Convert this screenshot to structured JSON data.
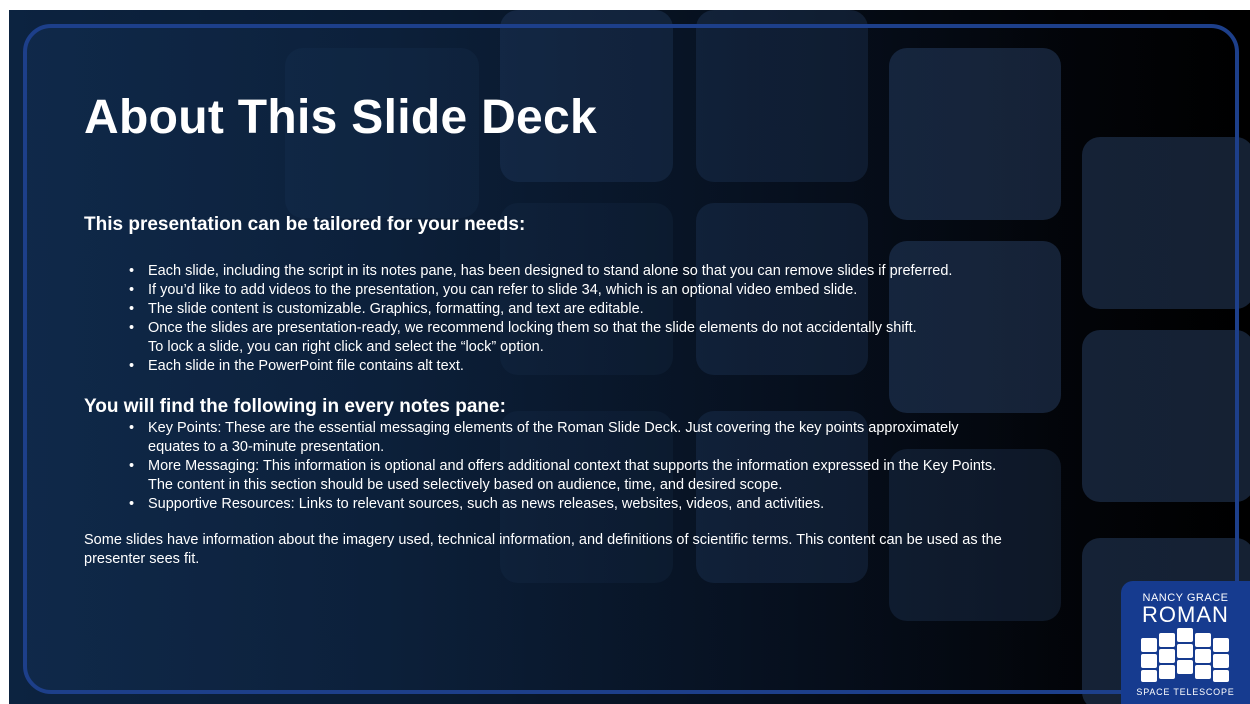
{
  "slide": {
    "title": "About This Slide Deck",
    "section1_heading": "This presentation can be tailored for your needs:",
    "section1_bullets": [
      "Each slide, including the script in its notes pane, has been designed to stand alone so that you can remove slides if preferred.",
      "If you’d like to add videos to the presentation, you can refer to slide 34, which is an optional video embed slide.",
      "The slide content is customizable. Graphics, formatting, and text are editable.",
      "Once the slides are presentation-ready, we recommend locking them so that the slide elements do not accidentally shift.",
      "To lock a slide, you can right click and select the “lock” option.",
      "Each slide in the PowerPoint file contains alt text."
    ],
    "section2_heading": "You will find the following in every notes pane:",
    "section2_bullets": [
      "Key Points: These are the essential messaging elements of the Roman Slide Deck. Just covering the key points approximately",
      "equates to a 30-minute presentation.",
      "More Messaging: This information is optional and offers additional context that supports the information expressed in the Key Points.",
      "The content in this section should be used selectively based on audience, time, and desired scope.",
      "Supportive Resources: Links to relevant sources, such as news releases, websites, videos, and activities."
    ],
    "closing_line1": "Some slides have information about the imagery used, technical information, and definitions of scientific terms. This content can be used as the",
    "closing_line2": "presenter sees fit."
  },
  "logo": {
    "line1": "NANCY GRACE",
    "line2": "ROMAN",
    "line3": "SPACE TELESCOPE"
  },
  "colors": {
    "frame_border": "#1d3f8a",
    "logo_background": "#163b8f",
    "text": "#ffffff"
  }
}
